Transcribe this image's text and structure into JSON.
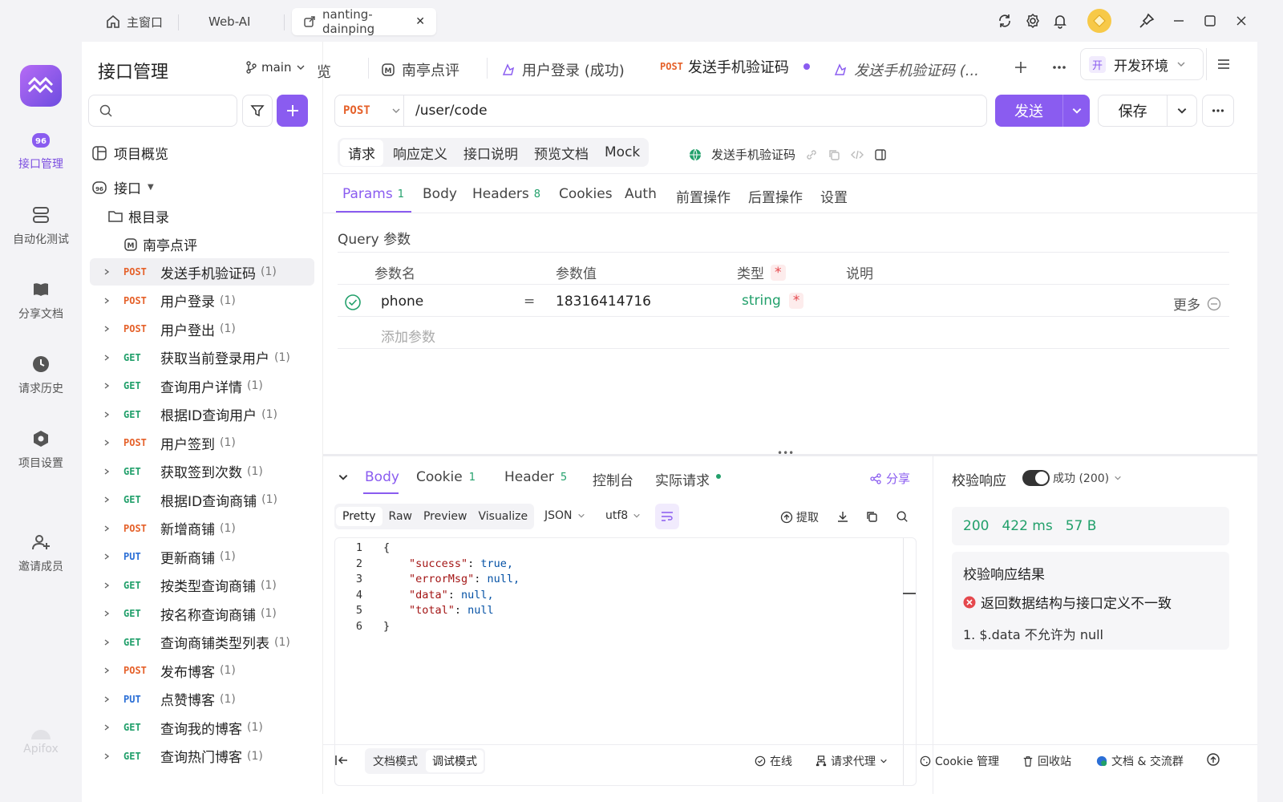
{
  "titlebar": {
    "tabs": [
      {
        "label": "主窗口",
        "icon": "home-icon"
      },
      {
        "label": "Web-AI"
      },
      {
        "label": "nanting-dainping",
        "icon": "link-icon",
        "close": "✕"
      }
    ],
    "icons": [
      "sync-icon",
      "settings-icon",
      "bell-icon",
      "avatar",
      "pin-icon",
      "minimize-icon",
      "maximize-icon",
      "close-icon"
    ]
  },
  "rail": {
    "items": [
      {
        "label": "接口管理",
        "icon": "api-icon"
      },
      {
        "label": "自动化测试",
        "icon": "automation-icon"
      },
      {
        "label": "分享文档",
        "icon": "book-icon"
      },
      {
        "label": "请求历史",
        "icon": "clock-icon"
      },
      {
        "label": "项目设置",
        "icon": "settings-icon"
      },
      {
        "label": "邀请成员",
        "icon": "add-user-icon"
      }
    ],
    "brand": "Apifox"
  },
  "sidebar": {
    "title": "接口管理",
    "branch": "main",
    "search_placeholder": "",
    "overview": "项目概览",
    "api_root": "接口",
    "root_dir": "根目录",
    "project": "南亭点评",
    "endpoints": [
      {
        "method": "POST",
        "name": "发送手机验证码",
        "count": "(1)"
      },
      {
        "method": "POST",
        "name": "用户登录",
        "count": "(1)"
      },
      {
        "method": "POST",
        "name": "用户登出",
        "count": "(1)"
      },
      {
        "method": "GET",
        "name": "获取当前登录用户",
        "count": "(1)"
      },
      {
        "method": "GET",
        "name": "查询用户详情",
        "count": "(1)"
      },
      {
        "method": "GET",
        "name": "根据ID查询用户",
        "count": "(1)"
      },
      {
        "method": "POST",
        "name": "用户签到",
        "count": "(1)"
      },
      {
        "method": "GET",
        "name": "获取签到次数",
        "count": "(1)"
      },
      {
        "method": "GET",
        "name": "根据ID查询商铺",
        "count": "(1)"
      },
      {
        "method": "POST",
        "name": "新增商铺",
        "count": "(1)"
      },
      {
        "method": "PUT",
        "name": "更新商铺",
        "count": "(1)"
      },
      {
        "method": "GET",
        "name": "按类型查询商铺",
        "count": "(1)"
      },
      {
        "method": "GET",
        "name": "按名称查询商铺",
        "count": "(1)"
      },
      {
        "method": "GET",
        "name": "查询商铺类型列表",
        "count": "(1)"
      },
      {
        "method": "POST",
        "name": "发布博客",
        "count": "(1)"
      },
      {
        "method": "PUT",
        "name": "点赞博客",
        "count": "(1)"
      },
      {
        "method": "GET",
        "name": "查询我的博客",
        "count": "(1)"
      },
      {
        "method": "GET",
        "name": "查询热门博客",
        "count": "(1)"
      }
    ]
  },
  "tabs": {
    "overflow_label": "览",
    "items": [
      {
        "label": "南亭点评"
      },
      {
        "label": "用户登录 (成功)"
      },
      {
        "method": "POST",
        "label": "发送手机验证码"
      },
      {
        "label": "发送手机验证码 (..."
      }
    ],
    "env": "开发环境",
    "env_badge": "开"
  },
  "request": {
    "method": "POST",
    "url": "/user/code",
    "send": "发送",
    "save": "保存"
  },
  "subtabs": {
    "items": [
      "请求",
      "响应定义",
      "接口说明",
      "预览文档",
      "Mock"
    ],
    "api_name": "发送手机验证码"
  },
  "params_tabs": [
    {
      "label": "Params",
      "badge": "1"
    },
    {
      "label": "Body"
    },
    {
      "label": "Headers",
      "badge": "8"
    },
    {
      "label": "Cookies"
    },
    {
      "label": "Auth"
    },
    {
      "label": "前置操作"
    },
    {
      "label": "后置操作"
    },
    {
      "label": "设置"
    }
  ],
  "query": {
    "title": "Query 参数",
    "headers": {
      "name": "参数名",
      "value": "参数值",
      "type": "类型",
      "required": "*",
      "desc": "说明"
    },
    "row": {
      "name": "phone",
      "eq": "=",
      "value": "18316414716",
      "type": "string",
      "required": "*",
      "more": "更多"
    },
    "add_placeholder": "添加参数"
  },
  "response": {
    "tabs": [
      {
        "label": "Body"
      },
      {
        "label": "Cookie",
        "badge": "1"
      },
      {
        "label": "Header",
        "badge": "5"
      },
      {
        "label": "控制台"
      },
      {
        "label": "实际请求"
      }
    ],
    "share": "分享",
    "views": [
      "Pretty",
      "Raw",
      "Preview",
      "Visualize"
    ],
    "format": "JSON",
    "encoding": "utf8",
    "extract": "提取",
    "code_lines": [
      {
        "n": "1",
        "text": "{"
      },
      {
        "n": "2",
        "key": "\"success\"",
        "val": "true,"
      },
      {
        "n": "3",
        "key": "\"errorMsg\"",
        "val": "null,"
      },
      {
        "n": "4",
        "key": "\"data\"",
        "val": "null,"
      },
      {
        "n": "5",
        "key": "\"total\"",
        "val": "null"
      },
      {
        "n": "6",
        "text": "}"
      }
    ]
  },
  "validation": {
    "label": "校验响应",
    "status": "成功 (200)",
    "code": "200",
    "time": "422 ms",
    "size": "57 B",
    "result_title": "校验响应结果",
    "error": "返回数据结构与接口定义不一致",
    "detail": "1. $.data 不允许为 null"
  },
  "statusbar": {
    "doc_mode": "文档模式",
    "debug_mode": "调试模式",
    "online": "在线",
    "proxy": "请求代理",
    "cookie": "Cookie 管理",
    "trash": "回收站",
    "docs": "文档 & 交流群"
  },
  "colors": {
    "accent": "#8a5cf0",
    "post": "#e5612a",
    "get": "#22a06b",
    "put": "#2b6fd6",
    "error": "#e5484d"
  }
}
